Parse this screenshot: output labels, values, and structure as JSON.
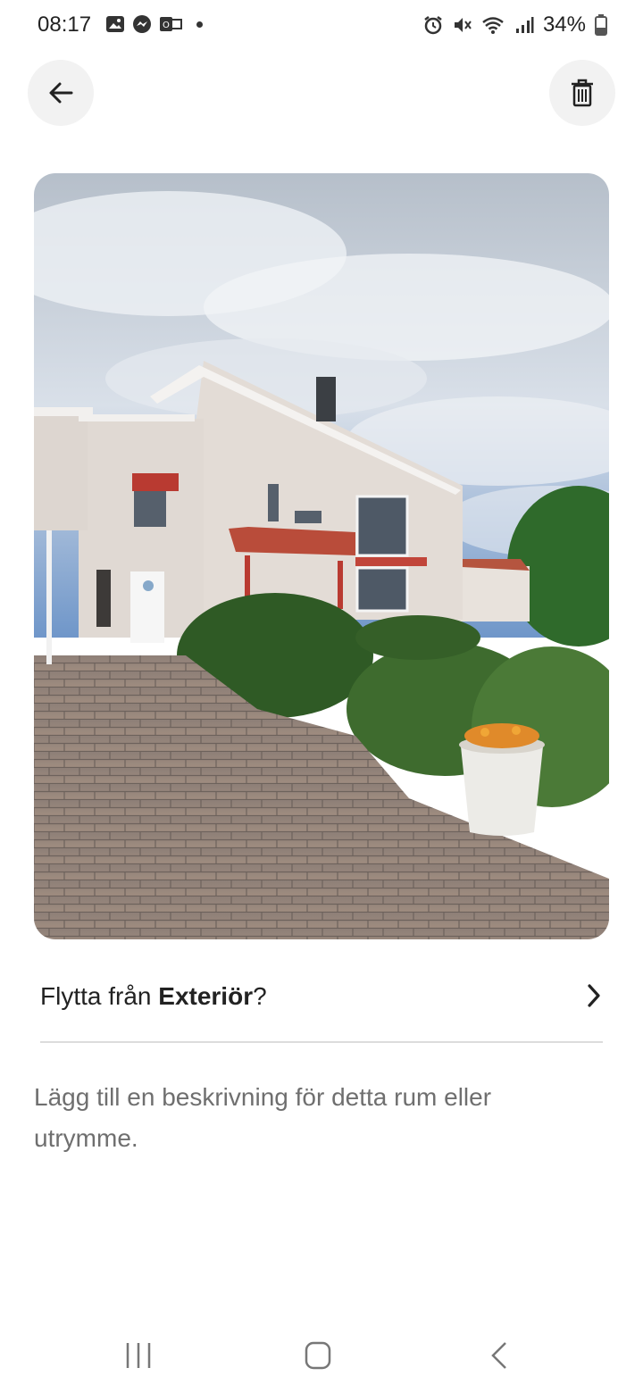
{
  "status_bar": {
    "time": "08:17",
    "left_icons": [
      "gallery-icon",
      "messenger-icon",
      "outlook-icon",
      "notification-dot"
    ],
    "right_icons": [
      "alarm-icon",
      "mute-icon",
      "wifi-icon",
      "signal-icon",
      "battery-icon"
    ],
    "battery": "34%"
  },
  "header": {
    "back_icon": "arrow-left-icon",
    "delete_icon": "trash-icon"
  },
  "photo": {
    "subject": "house-exterior-photo"
  },
  "move": {
    "prefix": "Flytta från ",
    "room": "Exteriör",
    "suffix": "?",
    "chevron_icon": "chevron-right-icon"
  },
  "description": {
    "placeholder": "Lägg till en beskrivning för detta rum eller utrymme."
  },
  "nav_bar": {
    "items": [
      "recent-apps-icon",
      "home-icon",
      "back-icon"
    ]
  },
  "colors": {
    "button_bg": "#f2f2f2",
    "divider": "#dcdcdc",
    "muted_text": "#6f6f6f"
  }
}
